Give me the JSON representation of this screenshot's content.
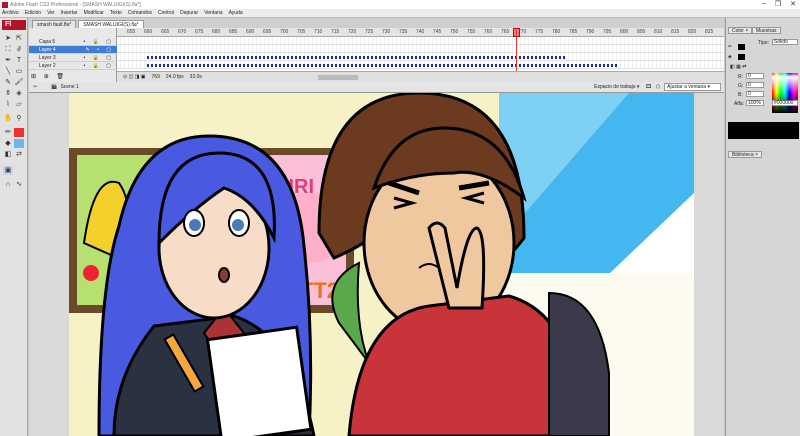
{
  "window": {
    "title": "Adobe Flash CS3 Professional - [SMASH WALUIGI(S).fla*]",
    "controls": [
      "–",
      "❐",
      "✕"
    ]
  },
  "menu": [
    "Archivo",
    "Edición",
    "Ver",
    "Insertar",
    "Modificar",
    "Texto",
    "Comandos",
    "Control",
    "Depurar",
    "Ventana",
    "Ayuda"
  ],
  "doc_tabs": [
    "smash fault.fla*",
    "SMASH WALUIGI(S).fla*"
  ],
  "logo": "Fl",
  "layers": [
    {
      "name": "Capa 5"
    },
    {
      "name": "Layer 4"
    },
    {
      "name": "Layer 3"
    },
    {
      "name": "Layer 2"
    }
  ],
  "ruler_ticks": [
    "655",
    "660",
    "665",
    "670",
    "675",
    "680",
    "685",
    "690",
    "695",
    "700",
    "705",
    "710",
    "715",
    "720",
    "725",
    "730",
    "735",
    "740",
    "745",
    "750",
    "755",
    "760",
    "765",
    "770",
    "775",
    "780",
    "785",
    "790",
    "795",
    "800",
    "805",
    "810",
    "815",
    "820",
    "825"
  ],
  "timeline_status": {
    "frame": "769",
    "fps": "24.0 fps",
    "time": "32.0s"
  },
  "scene": {
    "name": "Scene 1",
    "workspace": "Espacio de trabajo",
    "zoom": "Ajustar a ventana"
  },
  "panel": {
    "tabs": [
      "Color",
      "Muestras"
    ],
    "type_label": "Tipo:",
    "type_value": "Sólido",
    "r_label": "R:",
    "r_value": "0",
    "g_label": "G:",
    "g_value": "0",
    "b_label": "B:",
    "b_value": "0",
    "alpha_label": "Alfa:",
    "alpha_value": "100%",
    "hex_value": "#000000",
    "library_tab": "Biblioteca"
  },
  "stage_art": {
    "left_poster_text": "",
    "right_poster_text": "KIRI",
    "right_poster_text2": "UTT2"
  },
  "colors": {
    "stage_bg": "#f7f2c6",
    "sky": "#45b7f0",
    "hair_blue": "#4a5ae0",
    "hair_brown": "#6b3a1f",
    "skin": "#f0c8a0",
    "shirt_red": "#c8343a",
    "suit": "#2a3140"
  }
}
